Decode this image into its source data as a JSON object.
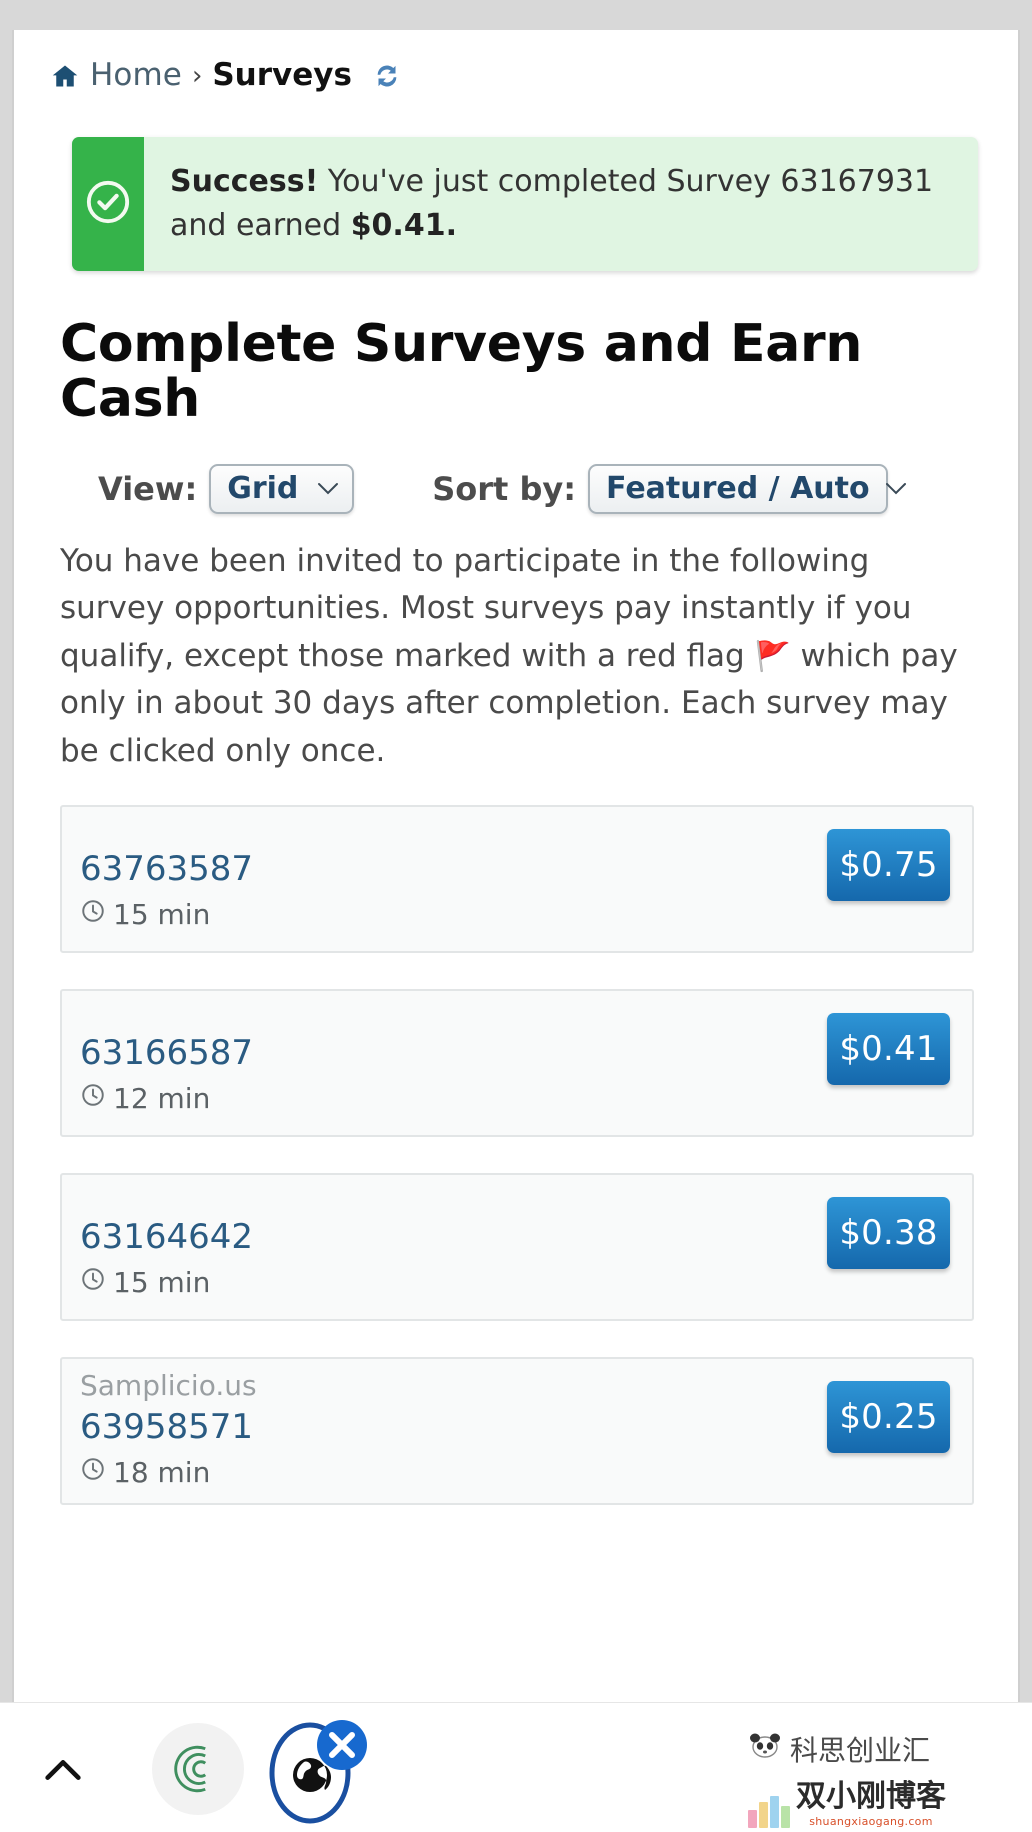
{
  "breadcrumb": {
    "home_icon": "home-icon",
    "home_label": "Home",
    "separator": "›",
    "current_label": "Surveys",
    "refresh_icon": "refresh-icon"
  },
  "alert": {
    "icon": "check-circle-icon",
    "strong": "Success!",
    "message": " You've just completed Survey 63167931 and earned ",
    "amount": "$0.41.",
    "accent_color": "#35b34a",
    "background_color": "#e0f5e2"
  },
  "page_title": "Complete Surveys and Earn Cash",
  "controls": {
    "view_label": "View:",
    "view_value": "Grid",
    "sort_label": "Sort by:",
    "sort_value": "Featured / Auto",
    "chevron_icon": "chevron-down-icon"
  },
  "intro": {
    "part1": "You have been invited to participate in the following survey opportunities. Most surveys pay instantly if you qualify, except those marked with a red flag ",
    "flag": "🚩",
    "part2": " which pay only in about 30 days after completion. Each survey may be clicked only once."
  },
  "surveys": [
    {
      "vendor": "",
      "id": "63763587",
      "duration": "15 min",
      "price": "$0.75",
      "clock_icon": "clock-icon"
    },
    {
      "vendor": "",
      "id": "63166587",
      "duration": "12 min",
      "price": "$0.41",
      "clock_icon": "clock-icon"
    },
    {
      "vendor": "",
      "id": "63164642",
      "duration": "15 min",
      "price": "$0.38",
      "clock_icon": "clock-icon"
    },
    {
      "vendor": "Samplicio.us",
      "id": "63958571",
      "duration": "18 min",
      "price": "$0.25",
      "clock_icon": "clock-icon"
    }
  ],
  "bottom_bar": {
    "up_icon": "chevron-up-icon",
    "loading_icon": "spinner-icon",
    "globe_icon": "globe-icon",
    "close_badge_icon": "close-icon"
  },
  "watermark": {
    "account": "科思创业汇",
    "brand": "双小刚博客",
    "url": "shuangxiaogang.com"
  },
  "colors": {
    "link": "#2a5b82",
    "price_button": "#1d7dc4",
    "success": "#35b34a"
  }
}
